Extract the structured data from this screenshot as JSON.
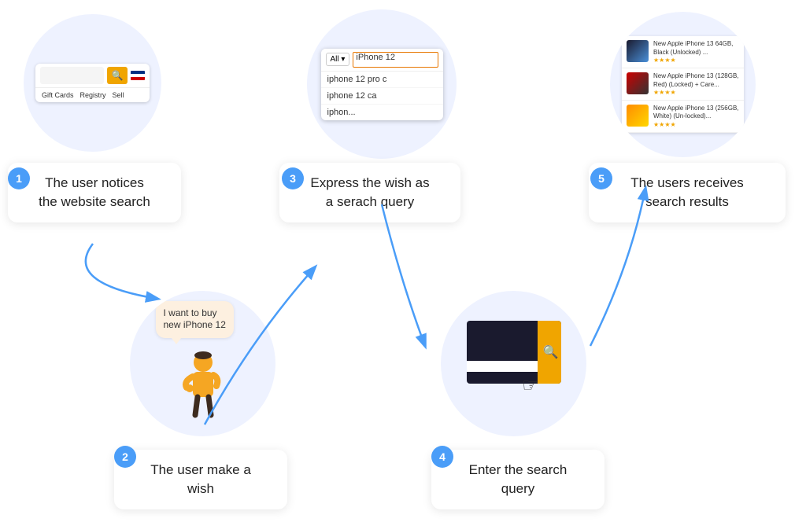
{
  "steps": {
    "badge1": "1",
    "badge2": "2",
    "badge3": "3",
    "badge4": "4",
    "badge5": "5"
  },
  "descriptions": {
    "step1": "The user notices\nthe website search",
    "step2": "The user make a\nwish",
    "step3": "Express the wish as\na serach query",
    "step4": "Enter the search\nquery",
    "step5": "The users receives\nsearch results"
  },
  "autocomplete": {
    "input_value": "iPhone 12",
    "all_label": "All ▾",
    "item1": "iphone 12 pro c",
    "item2": "iphone 12 ca",
    "item3": "iphon..."
  },
  "search_mockup": {
    "nav1": "Gift Cards",
    "nav2": "Registry",
    "nav3": "Sell"
  },
  "speech": {
    "line1": "I want to buy",
    "line2": "new iPhone 12"
  },
  "results": {
    "item1_title": "New Apple iPhone 13 64GB, Black (Unlocked) ...",
    "item2_title": "New Apple iPhone 13 (128GB, Red) (Locked) + Care...",
    "item3_title": "New Apple iPhone 13 (256GB, White) (Un-locked)...",
    "stars": "★★★★"
  }
}
